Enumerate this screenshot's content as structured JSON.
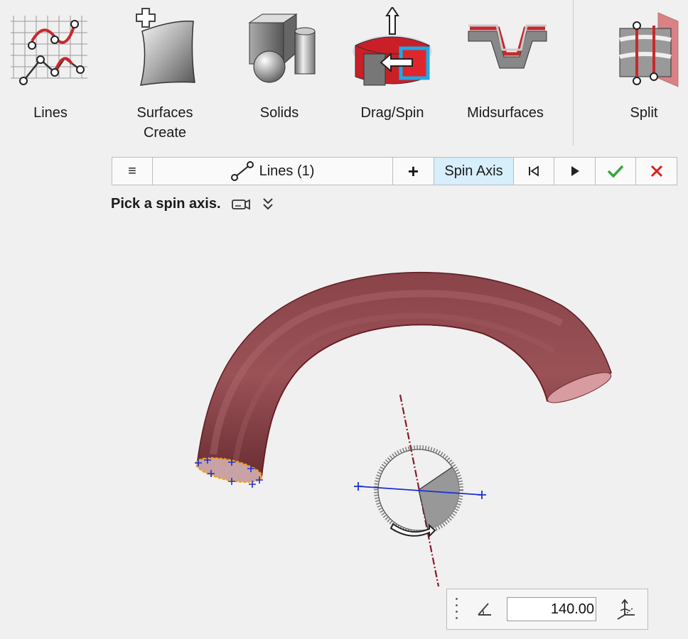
{
  "ribbon": {
    "tools": [
      {
        "label": "Lines",
        "icon": "lines-icon"
      },
      {
        "label": "Surfaces",
        "label2": "Create",
        "icon": "surfaces-create-icon"
      },
      {
        "label": "Solids",
        "icon": "solids-icon"
      },
      {
        "label": "Drag/Spin",
        "icon": "drag-spin-icon"
      },
      {
        "label": "Midsurfaces",
        "icon": "midsurfaces-icon"
      },
      {
        "label": "Split",
        "icon": "split-icon"
      }
    ]
  },
  "guidebar": {
    "menu_glyph": "≡",
    "selection_label": "Lines (1)",
    "add_glyph": "+",
    "spin_axis_label": "Spin Axis",
    "prev_glyph": "⏮",
    "play_glyph": "▶",
    "ok_glyph": "✔",
    "cancel_glyph": "✕"
  },
  "prompt": {
    "text": "Pick a spin axis."
  },
  "angle": {
    "value": "140.00"
  },
  "colors": {
    "tube": "#7b3a3f",
    "axis": "#8a1a2a",
    "spin_highlight": "#d7eefb",
    "ok": "#36a83a",
    "cancel": "#d81e1e"
  }
}
